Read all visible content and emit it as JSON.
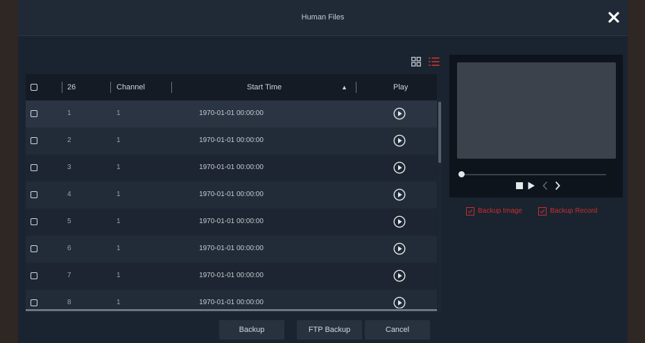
{
  "dialog": {
    "title": "Human Files",
    "close_icon": "close-icon"
  },
  "view_toggle": {
    "grid_icon": "grid-view-icon",
    "list_icon": "list-view-icon",
    "active": "list",
    "active_color": "#d0342c"
  },
  "table": {
    "headers": {
      "count": "26",
      "channel": "Channel",
      "start_time": "Start Time",
      "play": "Play"
    },
    "sort_indicator": "▲",
    "rows": [
      {
        "no": "1",
        "channel": "1",
        "start_time": "1970-01-01 00:00:00"
      },
      {
        "no": "2",
        "channel": "1",
        "start_time": "1970-01-01 00:00:00"
      },
      {
        "no": "3",
        "channel": "1",
        "start_time": "1970-01-01 00:00:00"
      },
      {
        "no": "4",
        "channel": "1",
        "start_time": "1970-01-01 00:00:00"
      },
      {
        "no": "5",
        "channel": "1",
        "start_time": "1970-01-01 00:00:00"
      },
      {
        "no": "6",
        "channel": "1",
        "start_time": "1970-01-01 00:00:00"
      },
      {
        "no": "7",
        "channel": "1",
        "start_time": "1970-01-01 00:00:00"
      },
      {
        "no": "8",
        "channel": "1",
        "start_time": "1970-01-01 00:00:00"
      }
    ]
  },
  "preview": {
    "progress": 0,
    "controls": [
      "stop-icon",
      "play-icon",
      "previous-icon",
      "next-icon"
    ]
  },
  "options": {
    "backup_image": "Backup Image",
    "backup_record": "Backup Record",
    "checked": true,
    "color": "#c9302c"
  },
  "buttons": {
    "backup": "Backup",
    "ftp_backup": "FTP Backup",
    "cancel": "Cancel"
  }
}
